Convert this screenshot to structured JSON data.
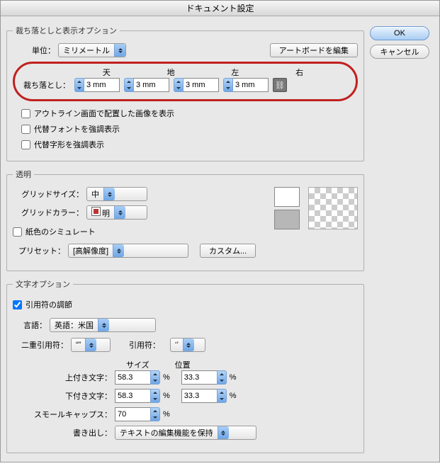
{
  "title": "ドキュメント設定",
  "buttons": {
    "ok": "OK",
    "cancel": "キャンセル"
  },
  "bleedSection": {
    "legend": "裁ち落としと表示オプション",
    "units_label": "単位：",
    "units_value": "ミリメートル",
    "edit_artboard": "アートボードを編集",
    "heads": {
      "top": "天",
      "bottom": "地",
      "left": "左",
      "right": "右"
    },
    "bleed_label": "裁ち落とし：",
    "bleed_top": "3 mm",
    "bleed_bottom": "3 mm",
    "bleed_left": "3 mm",
    "bleed_right": "3 mm",
    "cb_outline": "アウトライン画面で配置した画像を表示",
    "cb_altfont": "代替フォントを強調表示",
    "cb_altglyph": "代替字形を強調表示"
  },
  "transparency": {
    "legend": "透明",
    "grid_size_label": "グリッドサイズ：",
    "grid_size": "中",
    "grid_color_label": "グリッドカラー：",
    "grid_color": "明",
    "simulate_paper": "紙色のシミュレート",
    "preset_label": "プリセット：",
    "preset_value": "[高解像度]",
    "custom": "カスタム..."
  },
  "type": {
    "legend": "文字オプション",
    "smart_quotes": "引用符の調節",
    "lang_label": "言語：",
    "lang_value": "英語：米国",
    "dquote_label": "二重引用符：",
    "dquote_value": "“”",
    "squote_label": "引用符：",
    "squote_value": "‘’",
    "size_head": "サイズ",
    "pos_head": "位置",
    "super_label": "上付き文字：",
    "super_size": "58.3",
    "super_pos": "33.3",
    "sub_label": "下付き文字：",
    "sub_size": "58.3",
    "sub_pos": "33.3",
    "smallcaps_label": "スモールキャップス：",
    "smallcaps": "70",
    "export_label": "書き出し：",
    "export_value": "テキストの編集機能を保持",
    "pct": "%"
  }
}
